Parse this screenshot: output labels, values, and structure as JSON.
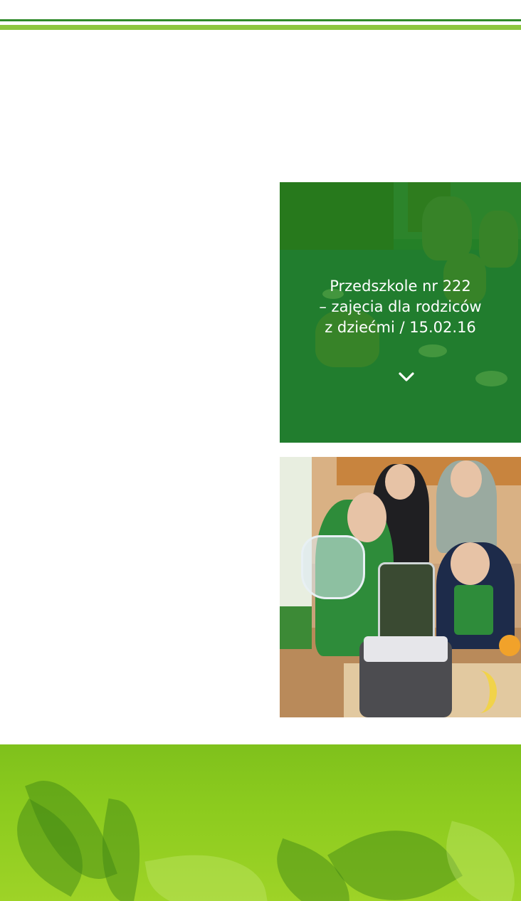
{
  "header": {
    "accent_dark": "#2f8a2a",
    "accent_light": "#8cc63f"
  },
  "gallery": {
    "cards": [
      {
        "title": "Przedszkole nr 222 – zajęcia dla rodziców z dziećmi / 15.02.16",
        "title_lines": [
          "Przedszkole nr 222",
          "– zajęcia dla rodziców",
          "z dziećmi / 15.02.16"
        ],
        "expand_icon": "chevron-down-icon",
        "overlay_color": "#148214"
      },
      {
        "image": "children-making-smoothie-photo"
      }
    ]
  },
  "footer": {
    "background": "green-vegetables-banner"
  }
}
